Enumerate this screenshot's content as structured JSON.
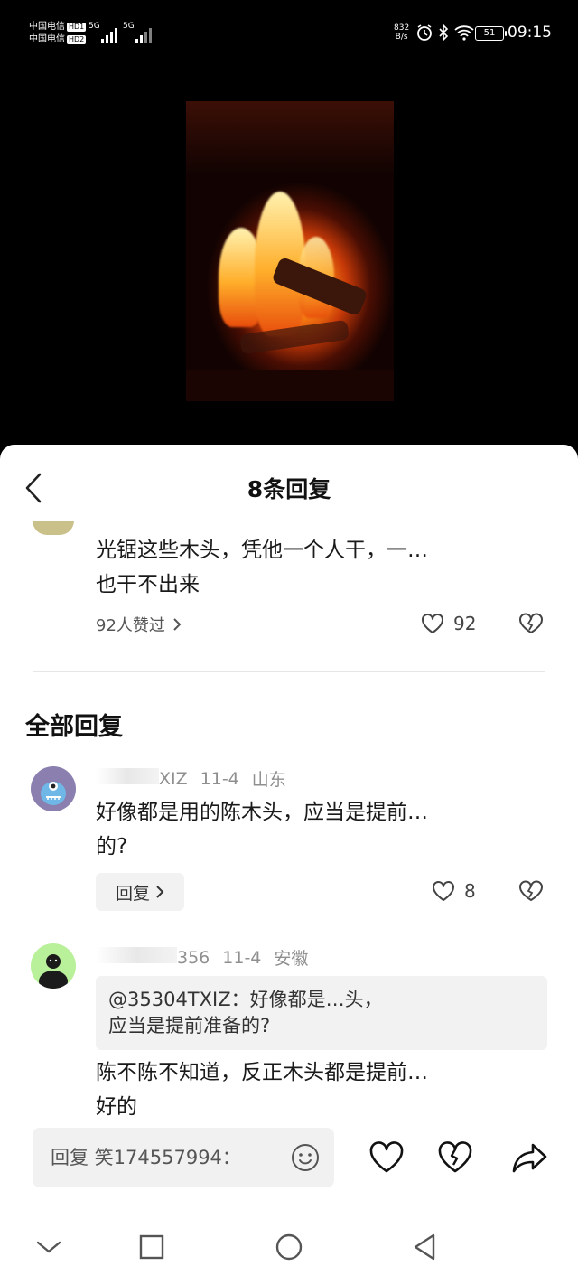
{
  "status_bar": {
    "carrier1": "中国电信",
    "carrier2": "中国电信",
    "hd1": "HD1",
    "hd2": "HD2",
    "net1": "5G",
    "net2": "5G",
    "speed_value": "832",
    "speed_unit": "B/s",
    "battery": "51",
    "time": "09:15"
  },
  "sheet": {
    "title": "8条回复",
    "original": {
      "text_line1": "光锯这些木头，凭他一个人干，一…",
      "text_line2": "也干不出来",
      "likes_summary": "92人赞过",
      "like_count": "92"
    },
    "section_title": "全部回复",
    "replies": [
      {
        "user_suffix": "XIZ",
        "date": "11-4",
        "location": "山东",
        "text_line1": "好像都是用的陈木头，应当是提前…",
        "text_line2": "的?",
        "reply_label": "回复",
        "like_count": "8"
      },
      {
        "user_suffix": "356",
        "date": "11-4",
        "location": "安徽",
        "quote_line1": "@35304TXIZ：好像都是…头，",
        "quote_line2": "应当是提前准备的?",
        "text_line1": "陈不陈不知道，反正木头都是提前…",
        "text_line2": "好的"
      }
    ],
    "input": {
      "placeholder": "回复 笑174557994："
    }
  },
  "icons": {
    "back": "chevron-left-icon",
    "like": "heart-outline-icon",
    "dislike": "broken-heart-icon",
    "emoji": "smiley-icon",
    "share": "share-arrow-icon"
  }
}
